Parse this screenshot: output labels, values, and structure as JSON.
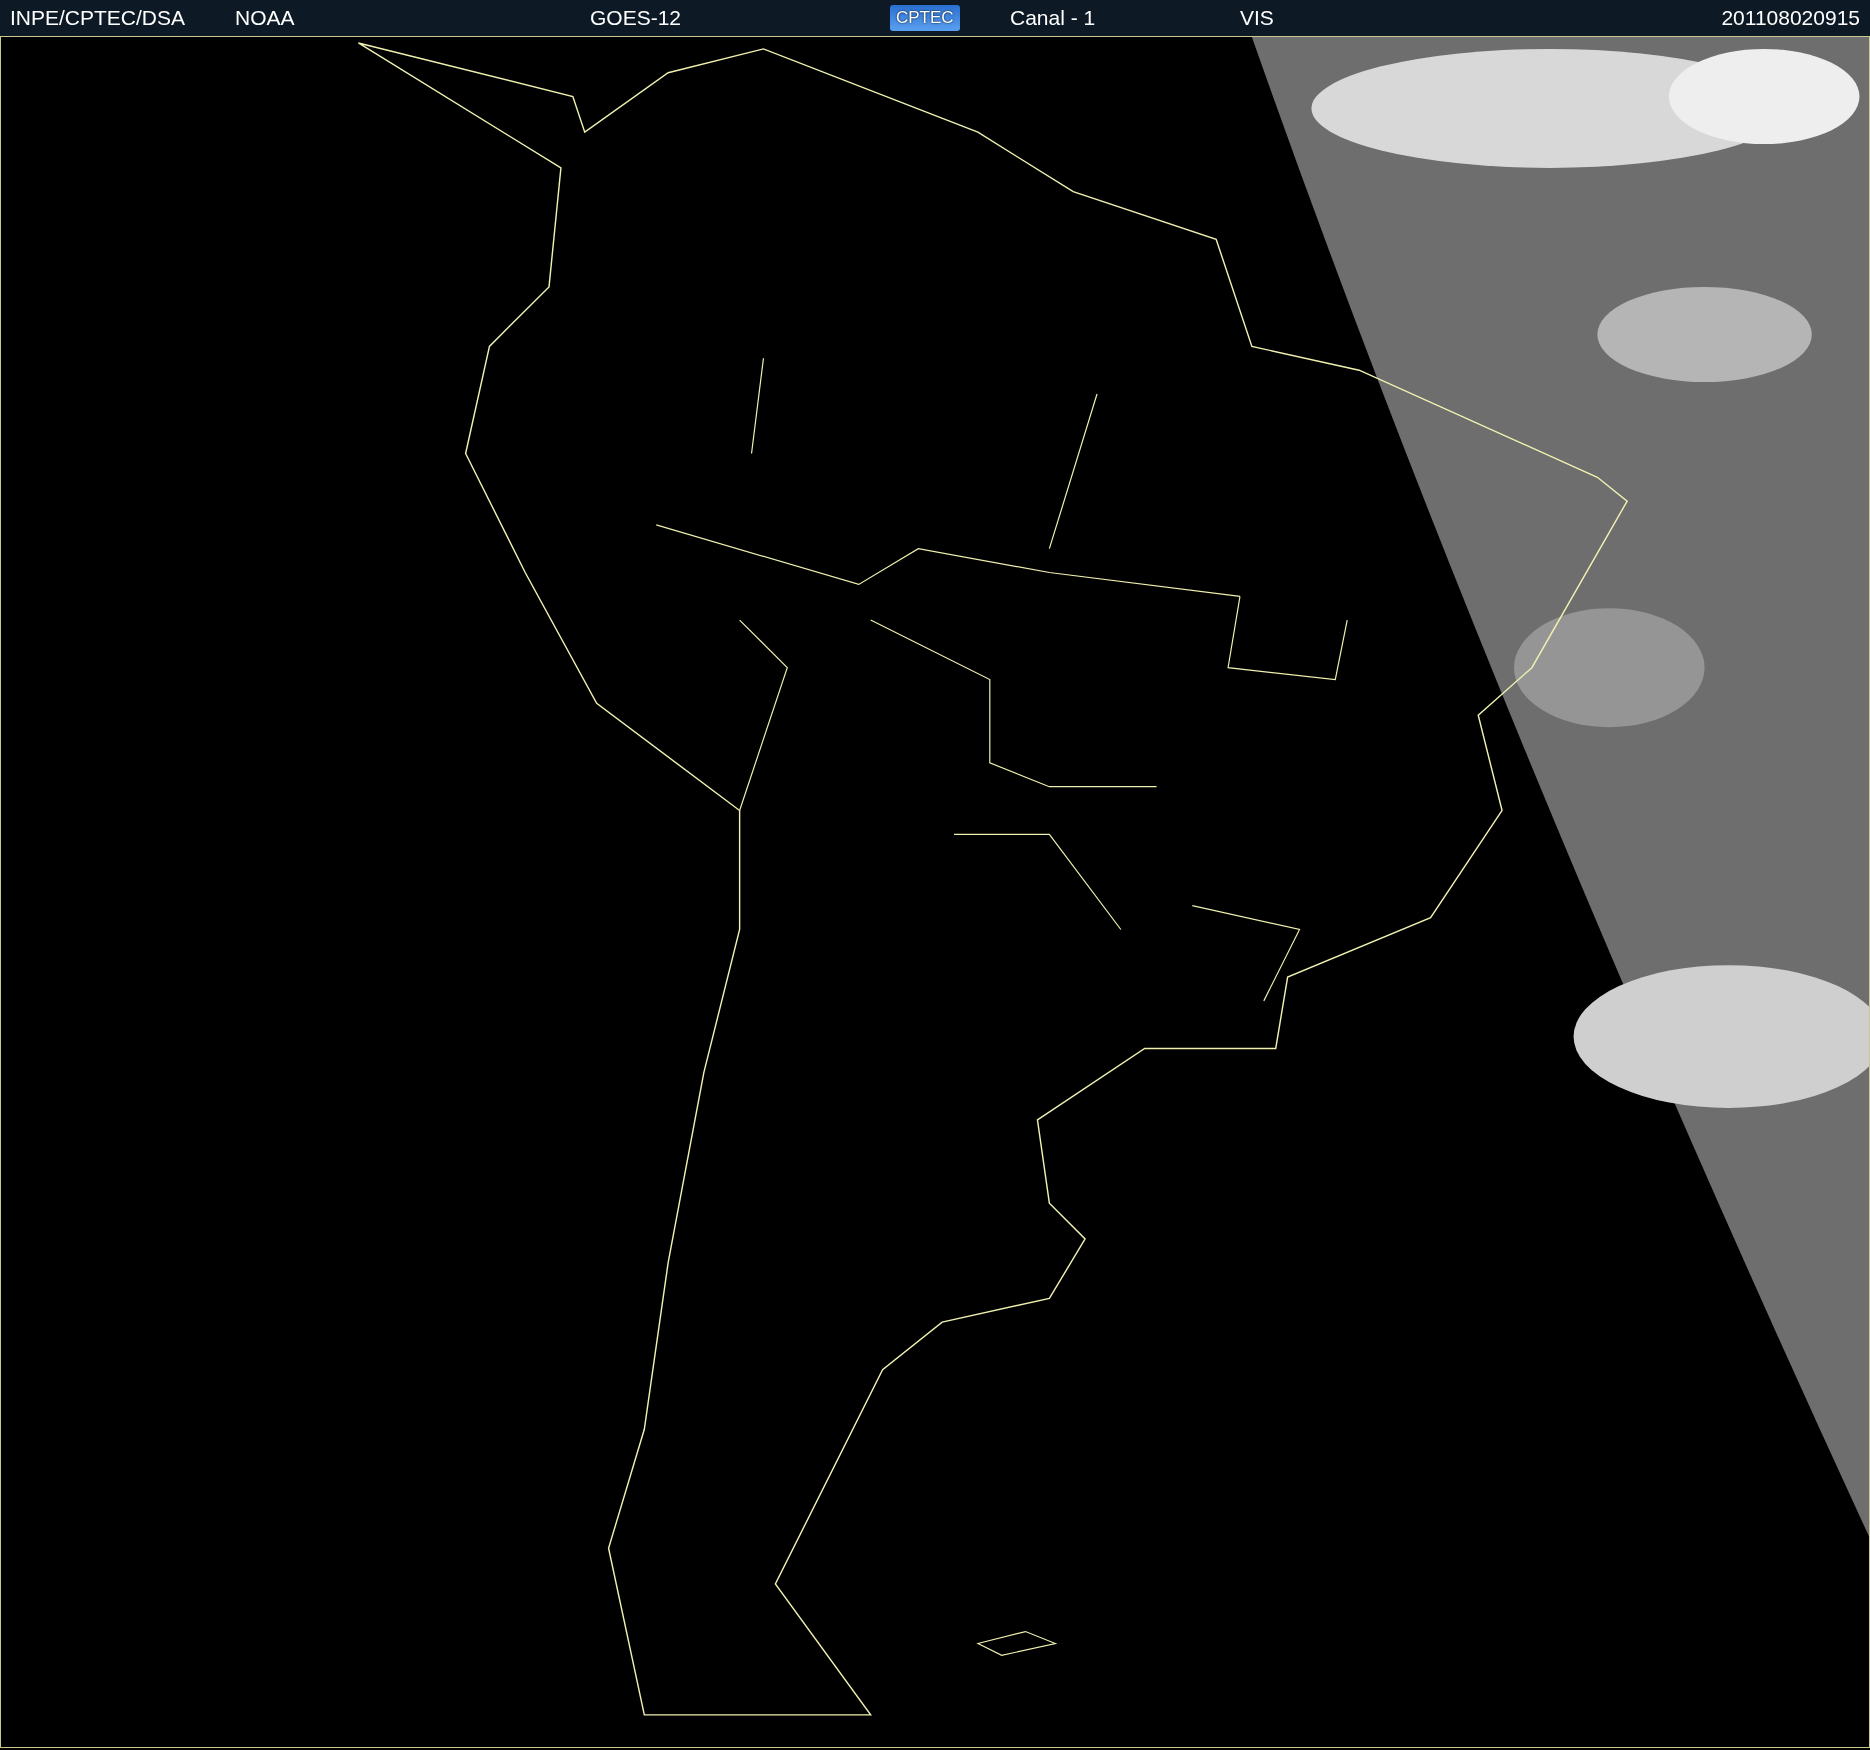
{
  "header": {
    "items": [
      {
        "kind": "text",
        "label": "INPE/CPTEC/DSA"
      },
      {
        "kind": "text",
        "label": "NOAA"
      },
      {
        "kind": "text",
        "label": "GOES-12"
      },
      {
        "kind": "logo",
        "label": "CPTEC"
      },
      {
        "kind": "text",
        "label": "Canal - 1"
      },
      {
        "kind": "text",
        "label": "VIS"
      },
      {
        "kind": "text",
        "label": "201108020915"
      }
    ]
  }
}
